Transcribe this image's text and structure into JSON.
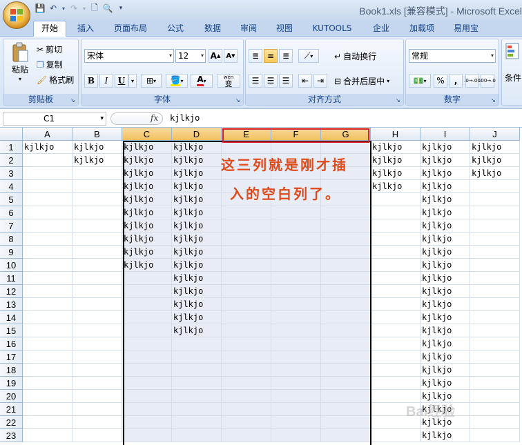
{
  "window": {
    "title": "Book1.xls  [兼容模式] - Microsoft Excel"
  },
  "quick_access": [
    "save-icon",
    "undo-icon",
    "redo-icon",
    "new-icon",
    "print-preview-icon",
    "customize-icon"
  ],
  "tabs": [
    "开始",
    "插入",
    "页面布局",
    "公式",
    "数据",
    "审阅",
    "视图",
    "KUTOOLS",
    "企业",
    "加载项",
    "易用宝"
  ],
  "active_tab": "开始",
  "ribbon": {
    "clipboard": {
      "label": "剪贴板",
      "paste": "粘贴",
      "cut": "剪切",
      "copy": "复制",
      "format_painter": "格式刷"
    },
    "font": {
      "label": "字体",
      "name": "宋体",
      "size": "12",
      "bold": "B",
      "italic": "I",
      "underline": "U",
      "grow": "A",
      "shrink": "A",
      "color_sample": "A",
      "wen": "wén",
      "wen_char": "变"
    },
    "alignment": {
      "label": "对齐方式",
      "wrap": "自动换行",
      "merge": "合并后居中"
    },
    "number": {
      "label": "数字",
      "format": "常规",
      "percent": "%",
      "comma": ",",
      "inc_decimal": ".0→.00",
      "dec_decimal": ".00→.0"
    },
    "styles": {
      "label": "条件"
    }
  },
  "formula_bar": {
    "name_box": "C1",
    "fx": "fx",
    "value": "kjlkjo"
  },
  "columns": [
    "A",
    "B",
    "C",
    "D",
    "E",
    "F",
    "G",
    "H",
    "I",
    "J"
  ],
  "selected_columns": [
    "C",
    "D",
    "E",
    "F",
    "G"
  ],
  "rows": [
    "1",
    "2",
    "3",
    "4",
    "5",
    "6",
    "7",
    "8",
    "9",
    "10",
    "11",
    "12",
    "13",
    "14",
    "15",
    "16",
    "17",
    "18",
    "19",
    "20",
    "21",
    "22",
    "23"
  ],
  "cells": [
    [
      "kjlkjo",
      "kjlkjo",
      "kjlkjo",
      "kjlkjo",
      "",
      "",
      "",
      "kjlkjo",
      "kjlkjo",
      "kjlkjo"
    ],
    [
      "",
      "kjlkjo",
      "kjlkjo",
      "kjlkjo",
      "",
      "",
      "",
      "kjlkjo",
      "kjlkjo",
      "kjlkjo"
    ],
    [
      "",
      "",
      "kjlkjo",
      "kjlkjo",
      "",
      "",
      "",
      "kjlkjo",
      "kjlkjo",
      "kjlkjo"
    ],
    [
      "",
      "",
      "kjlkjo",
      "kjlkjo",
      "",
      "",
      "",
      "kjlkjo",
      "kjlkjo",
      ""
    ],
    [
      "",
      "",
      "kjlkjo",
      "kjlkjo",
      "",
      "",
      "",
      "",
      "kjlkjo",
      ""
    ],
    [
      "",
      "",
      "kjlkjo",
      "kjlkjo",
      "",
      "",
      "",
      "",
      "kjlkjo",
      ""
    ],
    [
      "",
      "",
      "kjlkjo",
      "kjlkjo",
      "",
      "",
      "",
      "",
      "kjlkjo",
      ""
    ],
    [
      "",
      "",
      "kjlkjo",
      "kjlkjo",
      "",
      "",
      "",
      "",
      "kjlkjo",
      ""
    ],
    [
      "",
      "",
      "kjlkjo",
      "kjlkjo",
      "",
      "",
      "",
      "",
      "kjlkjo",
      ""
    ],
    [
      "",
      "",
      "kjlkjo",
      "kjlkjo",
      "",
      "",
      "",
      "",
      "kjlkjo",
      ""
    ],
    [
      "",
      "",
      "",
      "kjlkjo",
      "",
      "",
      "",
      "",
      "kjlkjo",
      ""
    ],
    [
      "",
      "",
      "",
      "kjlkjo",
      "",
      "",
      "",
      "",
      "kjlkjo",
      ""
    ],
    [
      "",
      "",
      "",
      "kjlkjo",
      "",
      "",
      "",
      "",
      "kjlkjo",
      ""
    ],
    [
      "",
      "",
      "",
      "kjlkjo",
      "",
      "",
      "",
      "",
      "kjlkjo",
      ""
    ],
    [
      "",
      "",
      "",
      "kjlkjo",
      "",
      "",
      "",
      "",
      "kjlkjo",
      ""
    ],
    [
      "",
      "",
      "",
      "",
      "",
      "",
      "",
      "",
      "kjlkjo",
      ""
    ],
    [
      "",
      "",
      "",
      "",
      "",
      "",
      "",
      "",
      "kjlkjo",
      ""
    ],
    [
      "",
      "",
      "",
      "",
      "",
      "",
      "",
      "",
      "kjlkjo",
      ""
    ],
    [
      "",
      "",
      "",
      "",
      "",
      "",
      "",
      "",
      "kjlkjo",
      ""
    ],
    [
      "",
      "",
      "",
      "",
      "",
      "",
      "",
      "",
      "kjlkjo",
      ""
    ],
    [
      "",
      "",
      "",
      "",
      "",
      "",
      "",
      "",
      "kjlkjo",
      ""
    ],
    [
      "",
      "",
      "",
      "",
      "",
      "",
      "",
      "",
      "kjlkjo",
      ""
    ],
    [
      "",
      "",
      "",
      "",
      "",
      "",
      "",
      "",
      "kjlkjo",
      ""
    ]
  ],
  "annotation": {
    "line1": "这三列就是刚才插",
    "line2": "入的空白列了。",
    "color": "#e04a1a",
    "box_color": "#d8222a"
  },
  "watermark": "Bai经验"
}
